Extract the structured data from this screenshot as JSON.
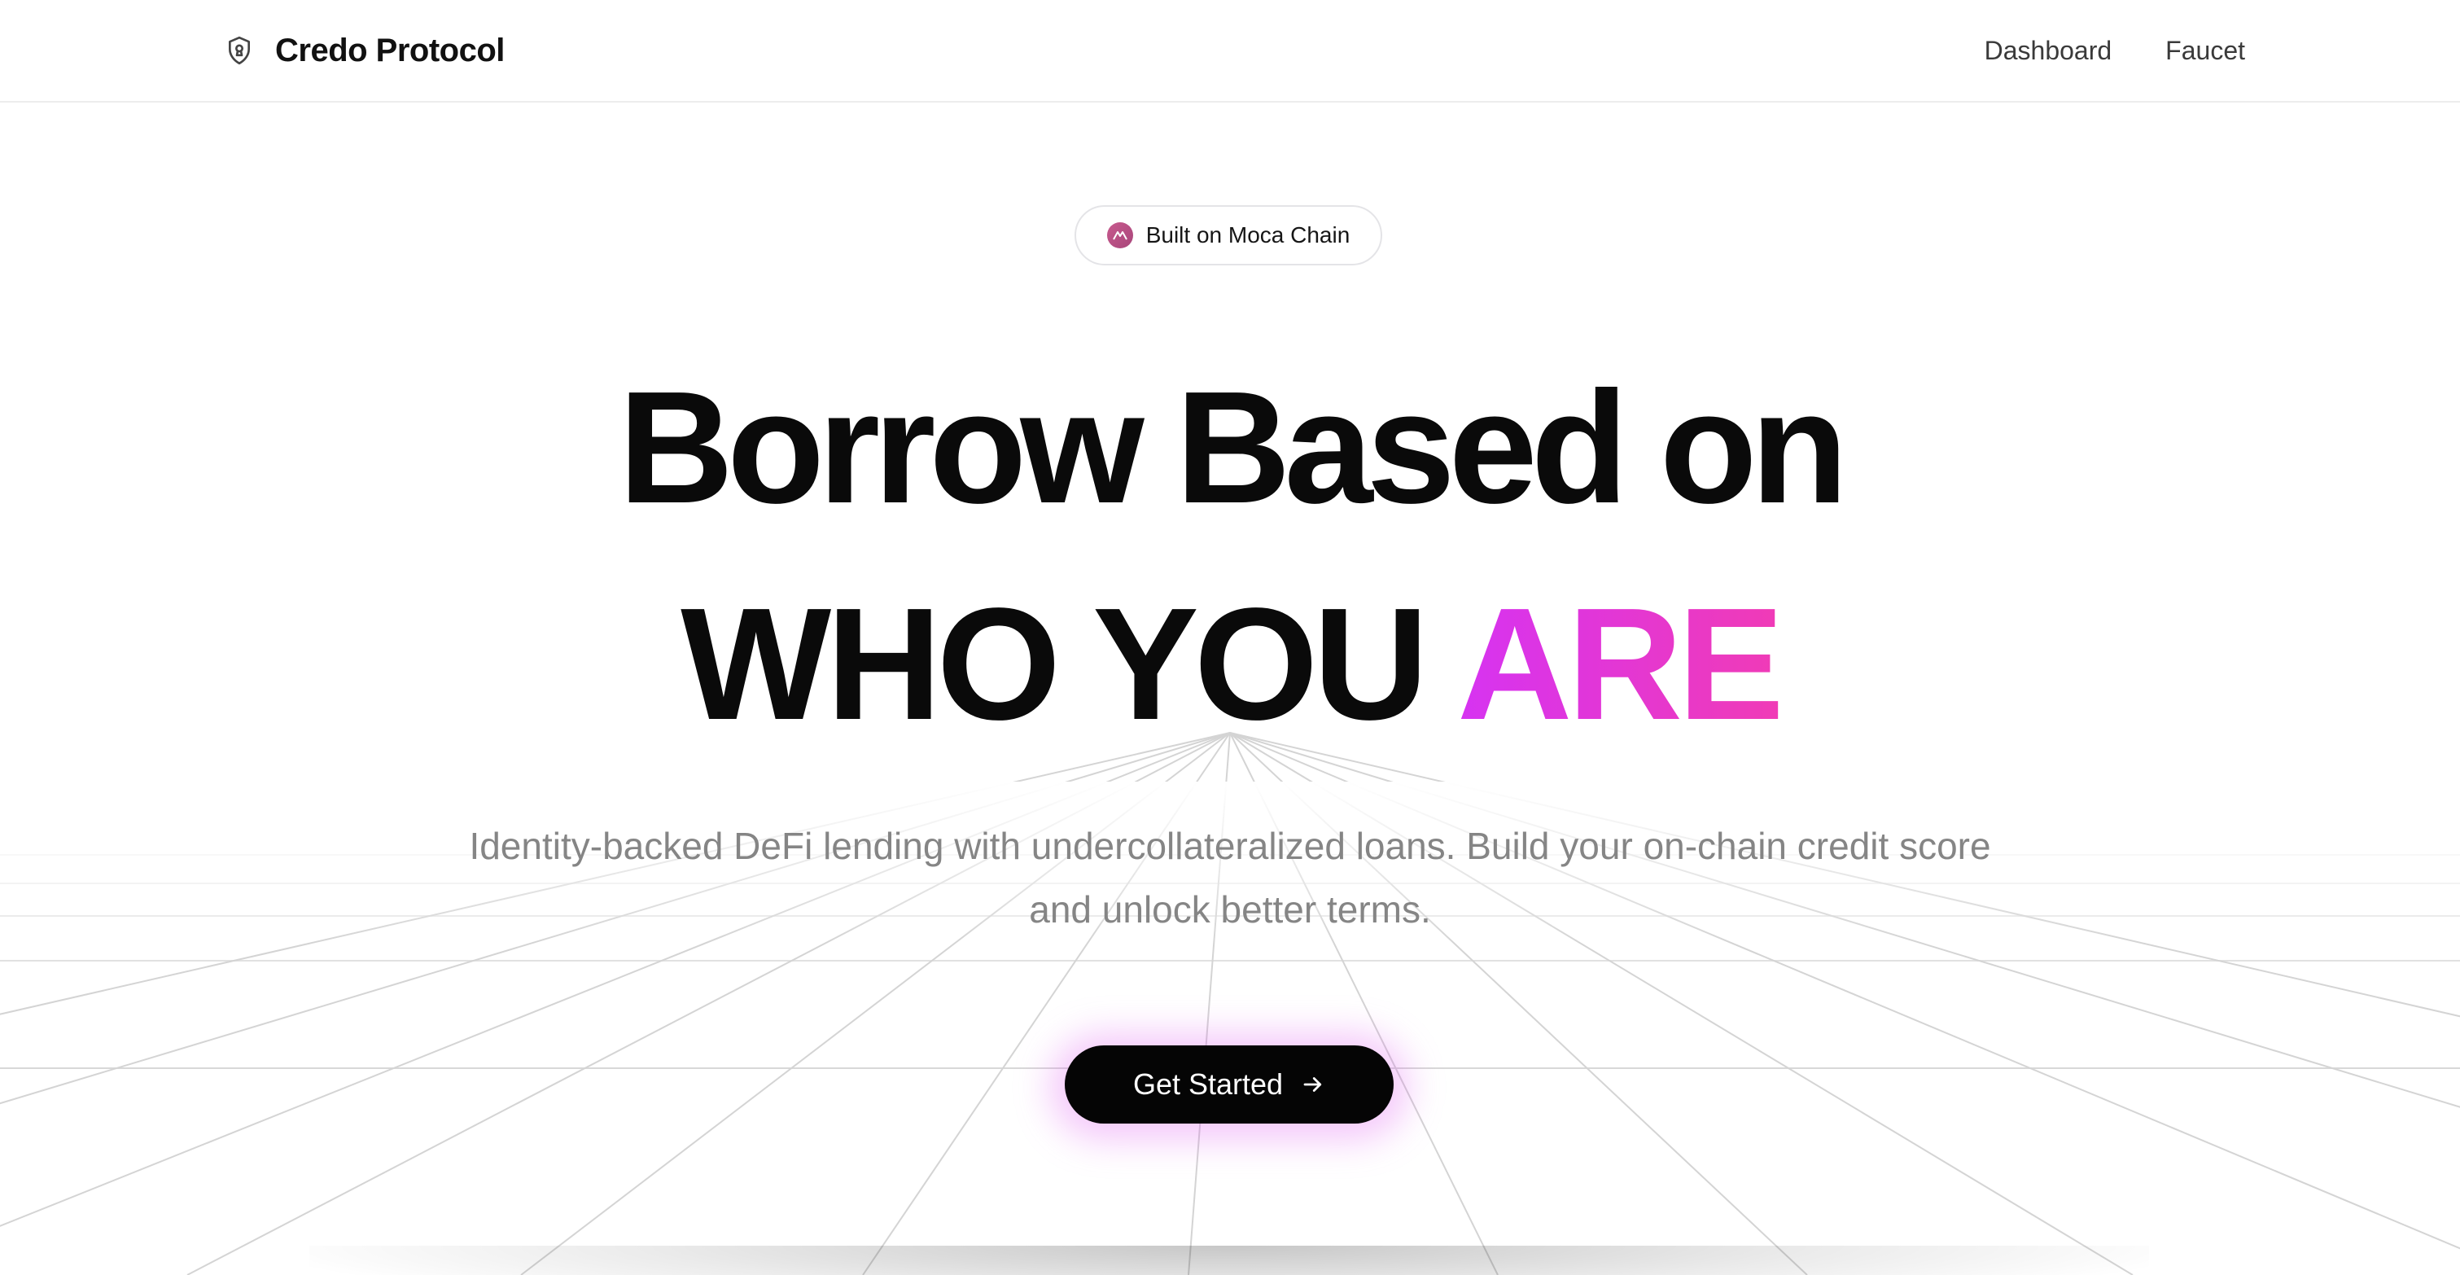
{
  "header": {
    "brand_name": "Credo Protocol",
    "brand_icon": "shield-icon",
    "nav": [
      {
        "label": "Dashboard"
      },
      {
        "label": "Faucet"
      }
    ]
  },
  "badge": {
    "icon": "moca-chain-logo",
    "label": "Built on Moca Chain"
  },
  "hero": {
    "headline_line1": "Borrow Based on",
    "headline_line2_plain": "WHO YOU ",
    "headline_line2_accent": "ARE",
    "subtitle": "Identity-backed DeFi lending with undercollateralized loans. Build your on-chain credit score and unlock better terms.",
    "cta_label": "Get Started",
    "cta_icon": "arrow-right-icon"
  },
  "colors": {
    "accent_start": "#d633f2",
    "accent_end": "#f03bb6",
    "cta_background": "#050505",
    "subtitle_text": "#858585"
  }
}
